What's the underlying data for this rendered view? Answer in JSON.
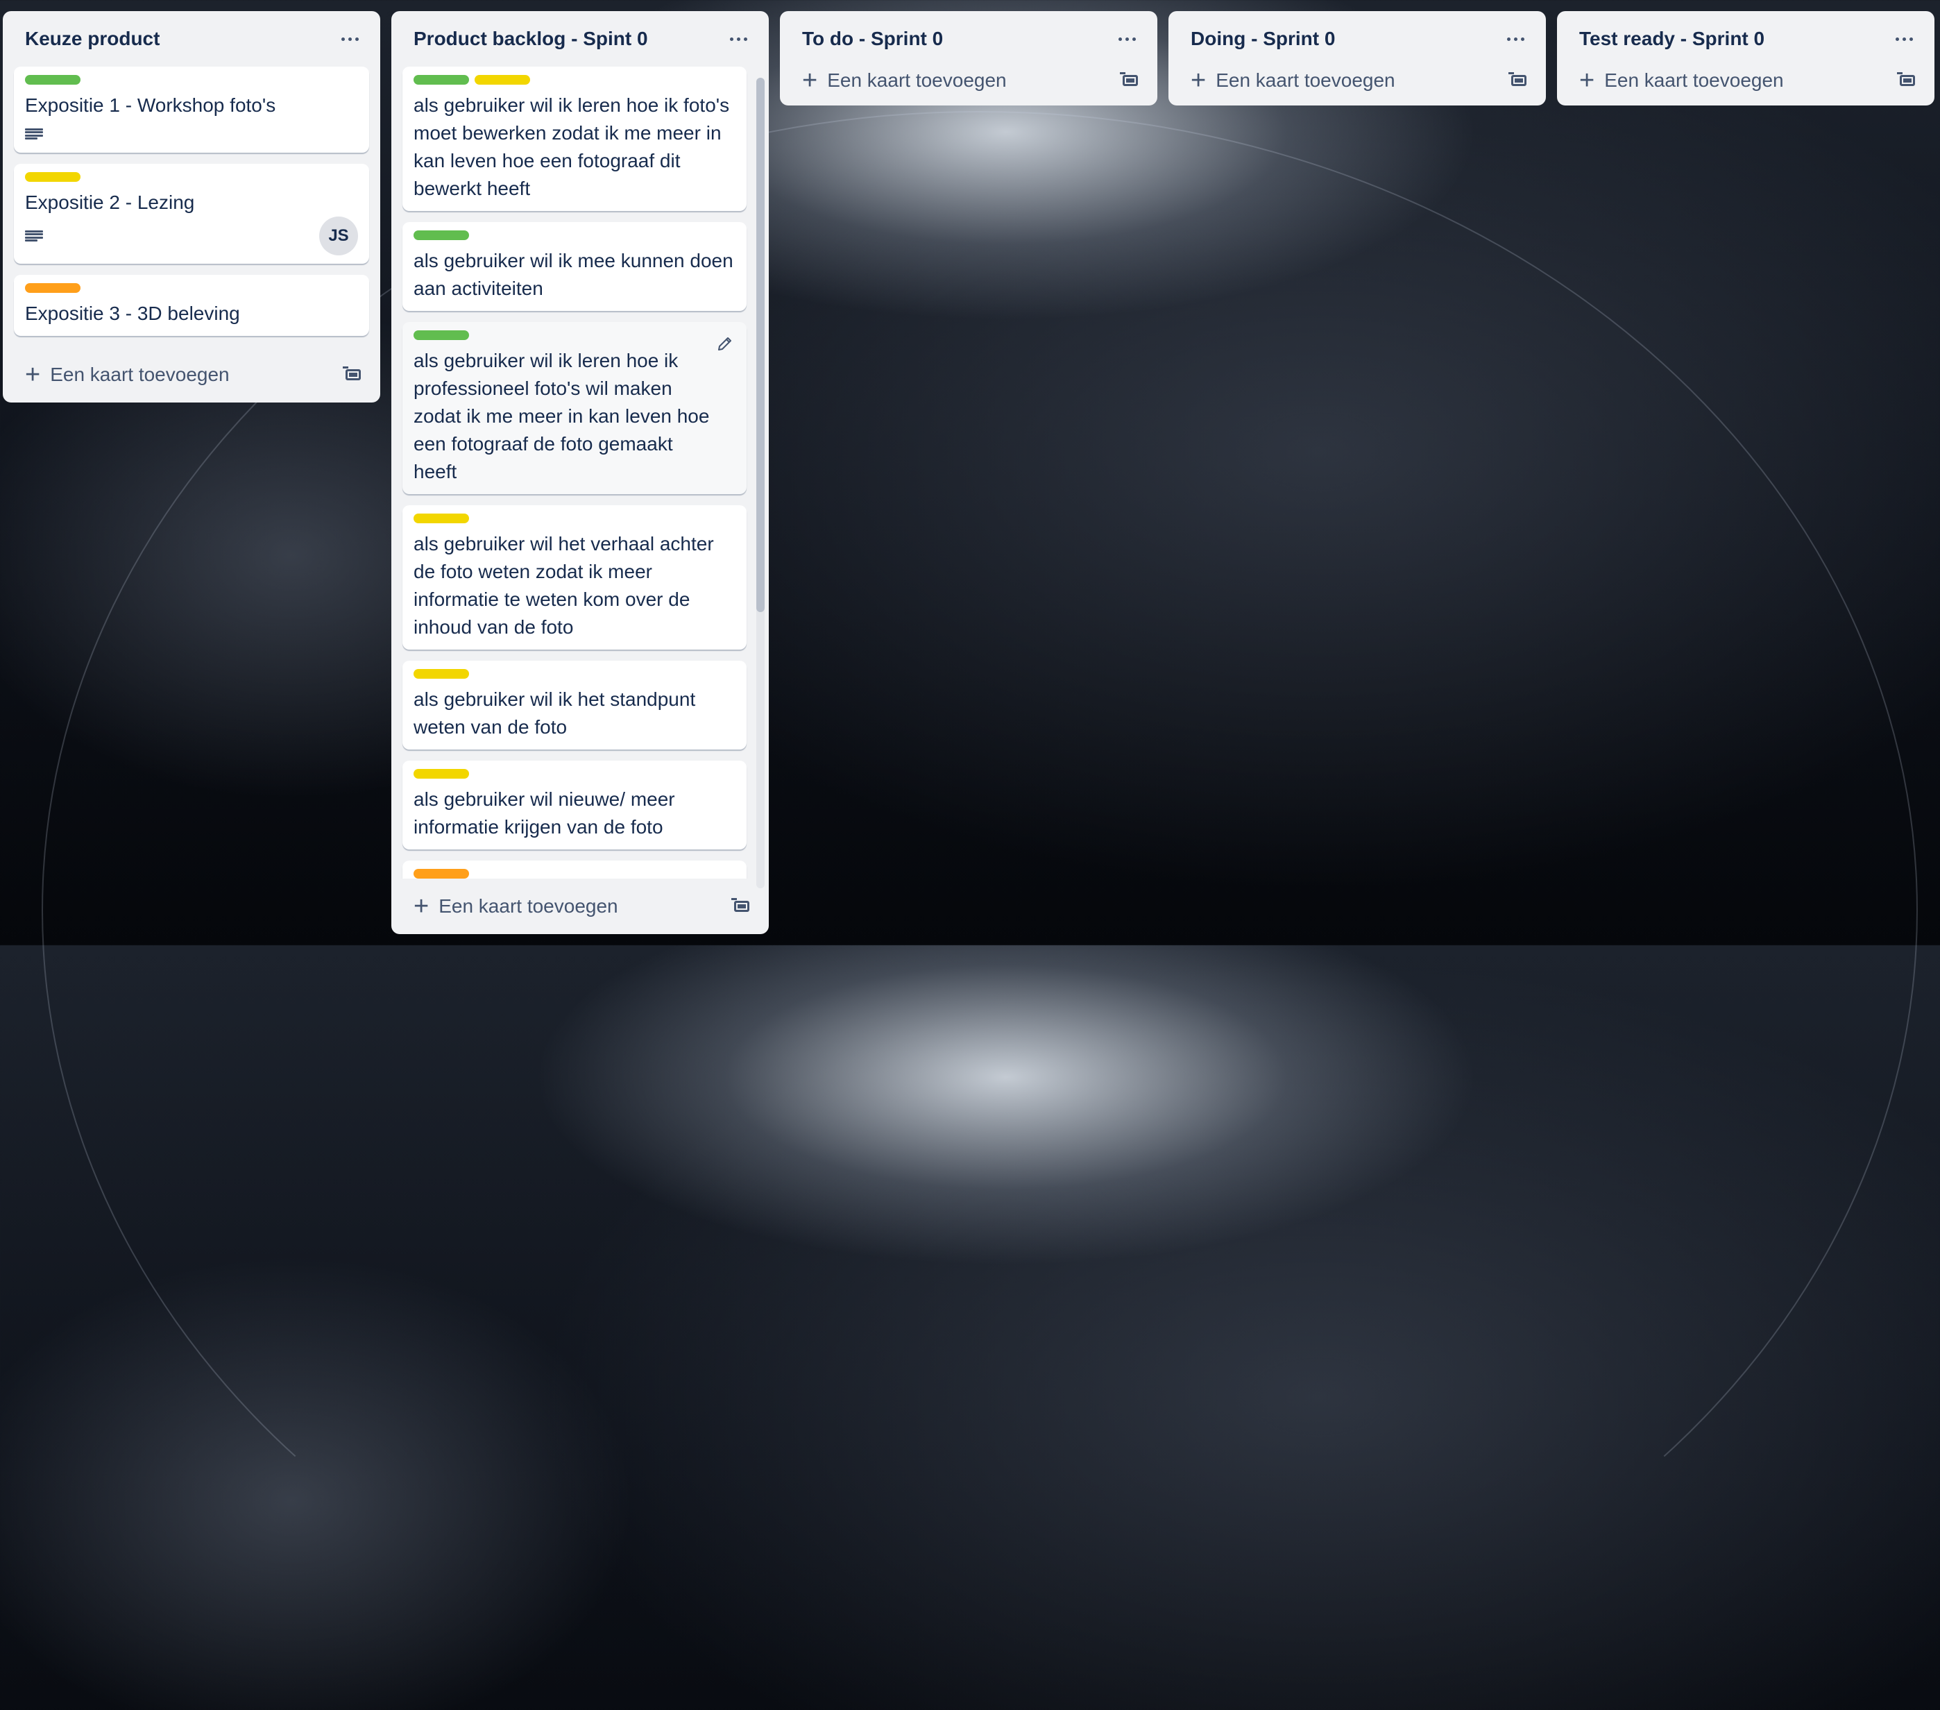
{
  "colors": {
    "green": "#61bd4f",
    "yellow": "#f2d600",
    "orange": "#ff9f1a",
    "list_bg": "#f1f2f4"
  },
  "add_card_label": "Een kaart toevoegen",
  "lists": [
    {
      "title": "Keuze product",
      "cards": [
        {
          "labels": [
            "green"
          ],
          "title": "Expositie 1 - Workshop foto's",
          "has_description": true
        },
        {
          "labels": [
            "yellow"
          ],
          "title": "Expositie 2 - Lezing",
          "has_description": true,
          "member": "JS"
        },
        {
          "labels": [
            "orange"
          ],
          "title": "Expositie 3 - 3D beleving"
        }
      ]
    },
    {
      "title": "Product backlog - Spint 0",
      "cards": [
        {
          "labels": [
            "green",
            "yellow"
          ],
          "title": "als gebruiker wil ik leren hoe ik foto's moet bewerken zodat ik me meer in kan leven hoe een fotograaf dit bewerkt heeft"
        },
        {
          "labels": [
            "green"
          ],
          "title": "als gebruiker wil ik mee kunnen doen aan activiteiten"
        },
        {
          "labels": [
            "green"
          ],
          "title": "als gebruiker wil ik leren hoe ik professioneel foto's wil maken zodat ik me meer in kan leven hoe een fotograaf de foto gemaakt heeft",
          "hover_edit": true
        },
        {
          "labels": [
            "yellow"
          ],
          "title": "als gebruiker wil het verhaal achter de foto weten zodat ik meer informatie te weten kom over de inhoud van de foto"
        },
        {
          "labels": [
            "yellow"
          ],
          "title": "als gebruiker wil ik het standpunt weten van de foto"
        },
        {
          "labels": [
            "yellow"
          ],
          "title": "als gebruiker wil nieuwe/ meer informatie krijgen van de foto"
        },
        {
          "labels": [
            "orange"
          ],
          "title": ""
        }
      ]
    },
    {
      "title": "To do - Sprint 0",
      "cards": []
    },
    {
      "title": "Doing - Sprint 0",
      "cards": []
    },
    {
      "title": "Test ready - Sprint 0",
      "cards": []
    }
  ]
}
